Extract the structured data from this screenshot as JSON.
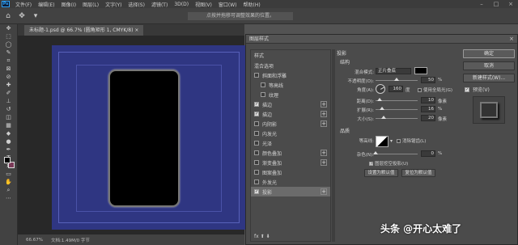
{
  "app": {
    "logo": "Ps",
    "menu": [
      "文件(F)",
      "编辑(E)",
      "图像(I)",
      "图层(L)",
      "文字(Y)",
      "选择(S)",
      "滤镜(T)",
      "3D(D)",
      "视图(V)",
      "窗口(W)",
      "帮助(H)"
    ],
    "option_hint": "点按并拖移可调整效果的位置。"
  },
  "document": {
    "tab_label": "未标题-1.psd @ 66.7% (圆角矩形 1, CMYK/8) ×",
    "zoom": "66.67%",
    "doc_info": "文档:1.49M/0 字节"
  },
  "dialog": {
    "title": "图层样式",
    "close": "×",
    "styles_header": "样式",
    "blend_options": "混合选项",
    "style_items": [
      {
        "label": "斜面和浮雕",
        "checked": false,
        "indent": false,
        "plus": false
      },
      {
        "label": "等高线",
        "checked": false,
        "indent": true,
        "plus": false
      },
      {
        "label": "纹理",
        "checked": false,
        "indent": true,
        "plus": false
      },
      {
        "label": "描边",
        "checked": true,
        "indent": false,
        "plus": true
      },
      {
        "label": "描边",
        "checked": true,
        "indent": false,
        "plus": true
      },
      {
        "label": "内阴影",
        "checked": false,
        "indent": false,
        "plus": true
      },
      {
        "label": "内发光",
        "checked": false,
        "indent": false,
        "plus": false
      },
      {
        "label": "光泽",
        "checked": false,
        "indent": false,
        "plus": false
      },
      {
        "label": "颜色叠加",
        "checked": false,
        "indent": false,
        "plus": true
      },
      {
        "label": "渐变叠加",
        "checked": false,
        "indent": false,
        "plus": true
      },
      {
        "label": "图案叠加",
        "checked": false,
        "indent": false,
        "plus": false
      },
      {
        "label": "外发光",
        "checked": false,
        "indent": false,
        "plus": false
      },
      {
        "label": "投影",
        "checked": true,
        "indent": false,
        "plus": true,
        "selected": true
      }
    ],
    "list_footer": "fx  ⬆  ⬇",
    "panel": {
      "section": "投影",
      "structure": "结构",
      "blend_mode_label": "混合模式:",
      "blend_mode_value": "正片叠底",
      "shadow_color": "#000000",
      "opacity_label": "不透明度(O):",
      "opacity_value": "50",
      "opacity_fraction": 0.5,
      "percent": "%",
      "angle_label": "角度(A):",
      "angle_value": "160",
      "angle_unit": "度",
      "global_light": "使用全局光(G)",
      "distance_label": "距离(D):",
      "distance_value": "10",
      "distance_fraction": 0.1,
      "spread_label": "扩展(R):",
      "spread_value": "16",
      "spread_fraction": 0.16,
      "size_label": "大小(S):",
      "size_value": "20",
      "size_fraction": 0.2,
      "px_unit": "像素",
      "quality": "品质",
      "contour_label": "等高线:",
      "antialias": "消除锯齿(L)",
      "noise_label": "杂色(N):",
      "noise_value": "0",
      "noise_fraction": 0,
      "knockout": "图层挖空投影(U)",
      "set_default": "设置为默认值",
      "reset_default": "复位为默认值"
    },
    "buttons": {
      "ok": "确定",
      "cancel": "取消",
      "new_style": "新建样式(W)...",
      "preview": "预览(V)"
    }
  },
  "watermark": "头条 @开心太难了"
}
